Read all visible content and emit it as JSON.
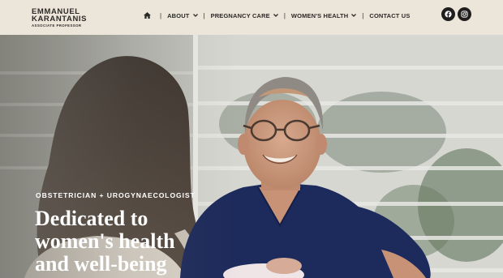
{
  "logo": {
    "line1": "EMMANUEL",
    "line2": "KARANTANIS",
    "subtitle": "ASSOCIATE PROFESSOR"
  },
  "nav": {
    "home_icon": "home-icon",
    "separator": "|",
    "items": [
      {
        "label": "ABOUT",
        "has_dropdown": true
      },
      {
        "label": "PREGNANCY CARE",
        "has_dropdown": true
      },
      {
        "label": "WOMEN'S HEALTH",
        "has_dropdown": true
      },
      {
        "label": "CONTACT US",
        "has_dropdown": false
      }
    ]
  },
  "social": [
    {
      "icon": "facebook-icon"
    },
    {
      "icon": "instagram-icon"
    }
  ],
  "hero": {
    "eyebrow": "OBSTETRICIAN + UROGYNAECOLOGIST",
    "headline_lines": [
      "Dedicated to",
      "women's health",
      "and well-being"
    ]
  },
  "colors": {
    "header_bg": "#ece5da",
    "text_dark": "#2b2a28",
    "scrubs": "#1c2a5c",
    "hero_text": "#ffffff"
  }
}
